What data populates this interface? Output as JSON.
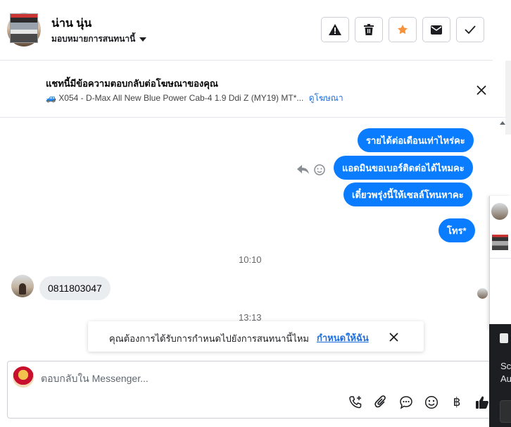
{
  "header": {
    "contact_name": "น่าน นุ่น",
    "assign_label": "มอบหมายการสนทนานี้",
    "actions": [
      "spam-icon",
      "trash-icon",
      "star-icon",
      "mail-icon",
      "check-icon"
    ],
    "star_color": "#f7923b"
  },
  "ad_banner": {
    "title": "แชทนี้มีข้อความตอบกลับต่อโฆษณาของคุณ",
    "ad_text": "🚙 X054 - D-Max All New Blue Power Cab-4 1.9 Ddi Z (MY19) MT*...",
    "view_ad_link": "ดูโฆษณา"
  },
  "messages": {
    "outgoing": [
      "รายได้ต่อเดือนเท่าไหร่คะ",
      "แอดมินขอเบอร์ติดต่อได้ไหมคะ",
      "เดี๋ยวพรุ่งนี้ให้เซลล์โทนหาคะ",
      "โทร*"
    ],
    "time_1": "10:10",
    "incoming": [
      "0811803047"
    ],
    "time_2": "13:13"
  },
  "toast": {
    "text": "คุณต้องการได้รับการกำหนดไปยังการสนทนานี้ไหม",
    "link": "กำหนดให้ฉัน"
  },
  "composer": {
    "placeholder": "ตอบกลับใน Messenger...",
    "tools": [
      "call-add-icon",
      "attachment-icon",
      "saved-replies-icon",
      "emoji-icon",
      "baht-icon",
      "thumbs-up-icon"
    ],
    "baht_symbol": "฿"
  },
  "side_panel": {
    "line1": "Sc",
    "line2": "Au"
  },
  "colors": {
    "bubble_out": "#0a7cff",
    "bubble_in": "#eaedf0",
    "link": "#216fdb"
  }
}
